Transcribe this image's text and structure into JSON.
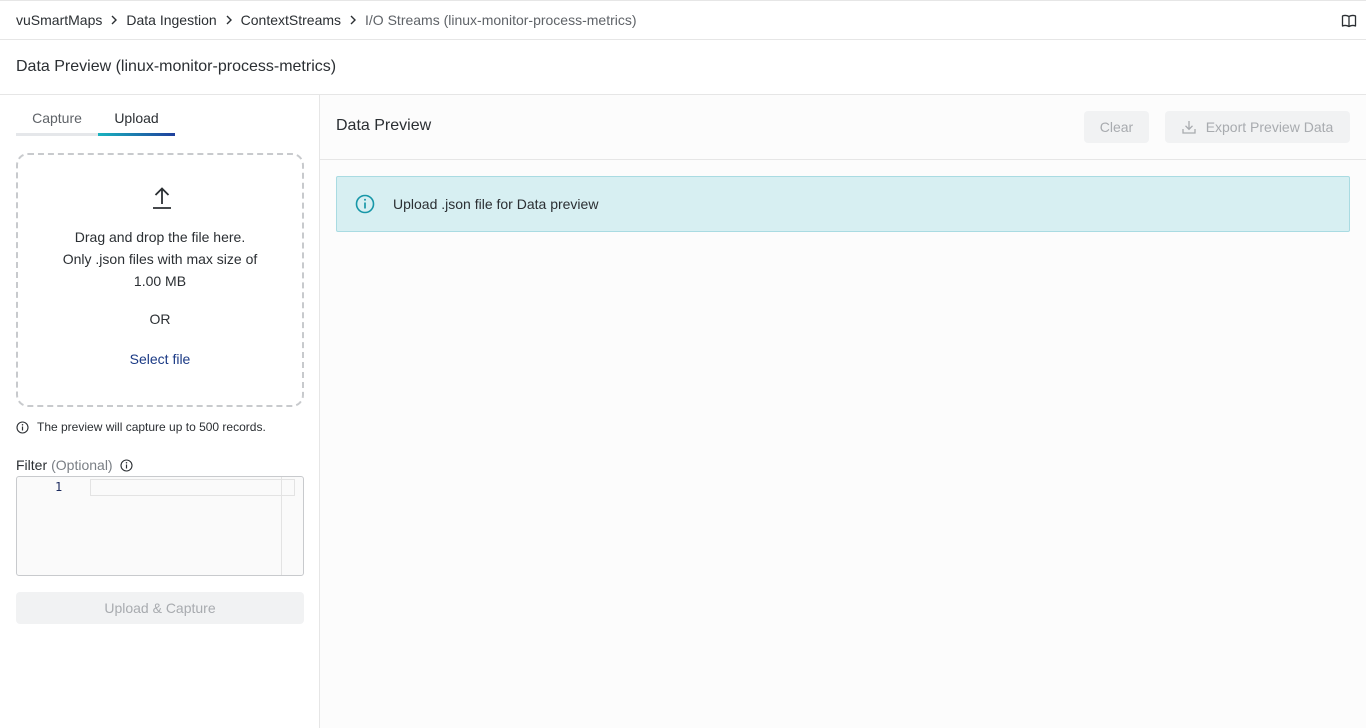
{
  "breadcrumb": {
    "items": [
      "vuSmartMaps",
      "Data Ingestion",
      "ContextStreams",
      "I/O Streams (linux-monitor-process-metrics)"
    ]
  },
  "page_title": "Data Preview (linux-monitor-process-metrics)",
  "left_panel": {
    "tabs": [
      {
        "label": "Capture",
        "active": false
      },
      {
        "label": "Upload",
        "active": true
      }
    ],
    "dropzone": {
      "line1": "Drag and drop the file here.",
      "line2": "Only .json files with max size of",
      "line3": "1.00 MB",
      "or": "OR",
      "select_file": "Select file"
    },
    "note": "The preview will capture up to 500 records.",
    "filter": {
      "label": "Filter",
      "optional": "(Optional)",
      "line_number": "1"
    },
    "upload_button": "Upload & Capture"
  },
  "right_panel": {
    "title": "Data Preview",
    "clear_button": "Clear",
    "export_button": "Export Preview Data",
    "info_message": "Upload .json file for Data preview"
  },
  "icons": {
    "chevron": "chevron-right-icon",
    "docs": "book-icon",
    "upload": "upload-arrow-icon",
    "info": "info-icon",
    "download": "download-icon"
  },
  "colors": {
    "accent_gradient_start": "#19b3bf",
    "accent_gradient_end": "#1f3f9c",
    "link": "#1b3a85",
    "info_bg": "#d7eff2",
    "info_icon": "#1797a8"
  }
}
